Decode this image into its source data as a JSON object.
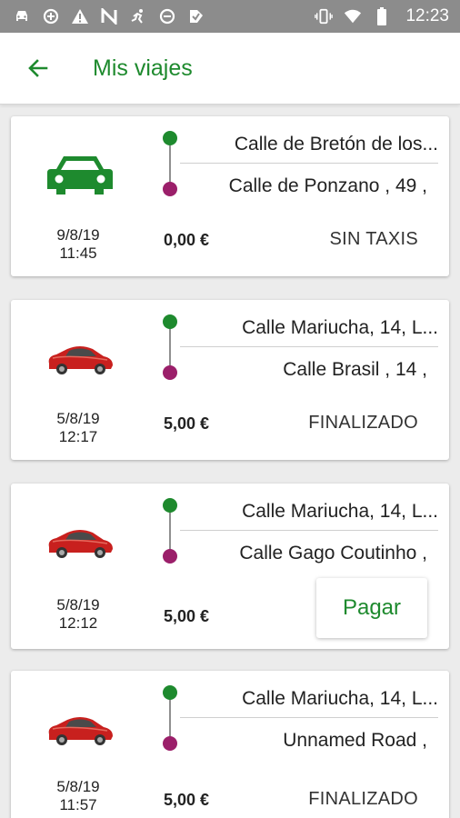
{
  "status_bar": {
    "time": "12:23",
    "left_icons": [
      "car-notification-icon",
      "sync-icon",
      "warning-icon",
      "n-app-icon",
      "runner-icon",
      "sync-icon-2",
      "app-check-icon"
    ],
    "right_icons": [
      "vibrate-icon",
      "wifi-icon",
      "battery-icon"
    ]
  },
  "app_bar": {
    "title": "Mis viajes",
    "back_icon": "arrow-back-icon"
  },
  "colors": {
    "accent": "#1e8a2e",
    "origin_dot": "#1e8a2e",
    "destination_dot": "#9b1f6a",
    "taxi_icon": "#1e8a2e",
    "car_photo": "#c8201e"
  },
  "trips": [
    {
      "vehicle_icon": "taxi-car-icon",
      "date": "9/8/19",
      "time": "11:45",
      "origin": "Calle de Bretón de los...",
      "destination": "Calle de Ponzano , 49 ,",
      "price": "0,00 €",
      "status": "SIN TAXIS",
      "action": null
    },
    {
      "vehicle_icon": "red-car-icon",
      "date": "5/8/19",
      "time": "12:17",
      "origin": "Calle Mariucha, 14, L...",
      "destination": "Calle Brasil , 14 ,",
      "price": "5,00 €",
      "status": "FINALIZADO",
      "action": null
    },
    {
      "vehicle_icon": "red-car-icon",
      "date": "5/8/19",
      "time": "12:12",
      "origin": "Calle Mariucha, 14, L...",
      "destination": "Calle Gago Coutinho ,",
      "price": "5,00 €",
      "status": null,
      "action": "Pagar"
    },
    {
      "vehicle_icon": "red-car-icon",
      "date": "5/8/19",
      "time": "11:57",
      "origin": "Calle Mariucha, 14, L...",
      "destination": "Unnamed Road ,",
      "price": "5,00 €",
      "status": "FINALIZADO",
      "action": null
    }
  ]
}
